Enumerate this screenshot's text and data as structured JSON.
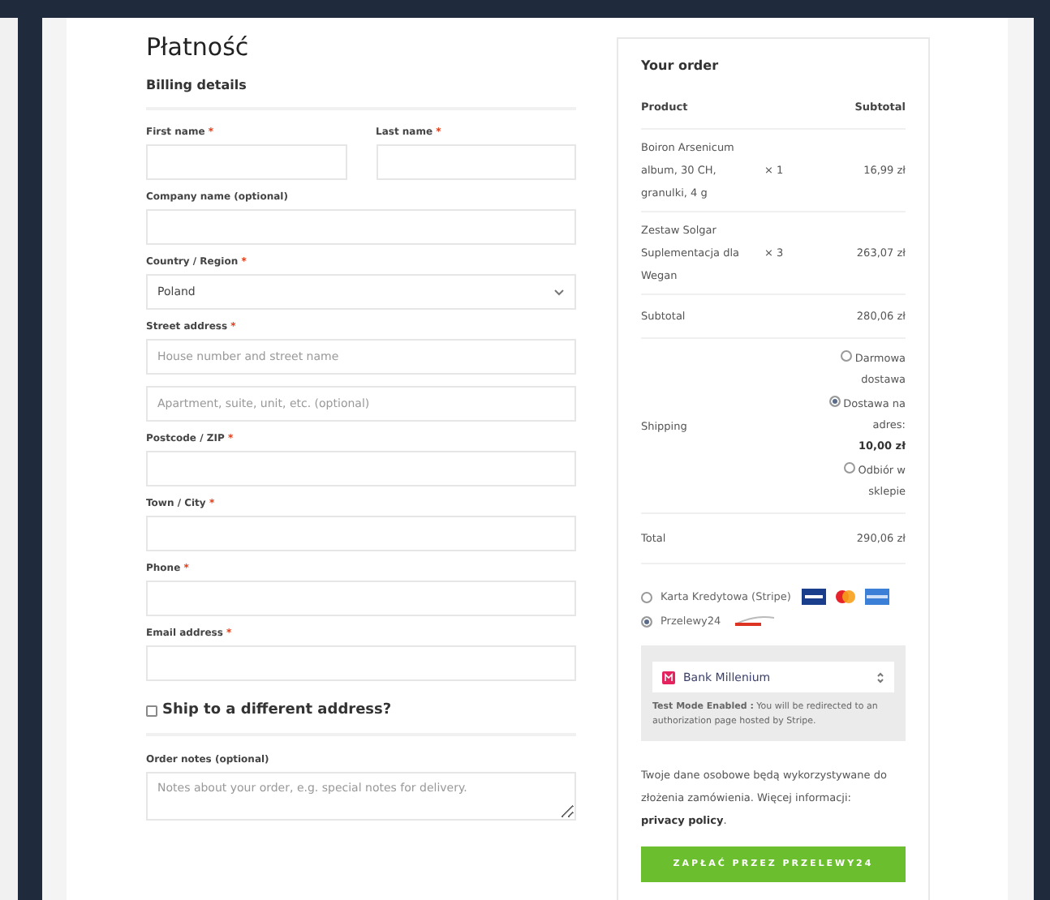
{
  "title": "Płatność",
  "billing": {
    "heading": "Billing details",
    "fields": [
      {
        "kind": "text",
        "label": "First name",
        "mark": "*",
        "half": true
      },
      {
        "kind": "text",
        "label": "Last name",
        "mark": "*",
        "half": true
      },
      {
        "kind": "text",
        "label": "Company name (optional)"
      },
      {
        "kind": "select",
        "label": "Country / Region",
        "mark": "*",
        "value": "Poland"
      },
      {
        "kind": "text",
        "label": "Street address",
        "mark": "*",
        "placeholder": "House number and street name"
      },
      {
        "kind": "text",
        "placeholder": "Apartment, suite, unit, etc. (optional)"
      },
      {
        "kind": "text",
        "label": "Postcode / ZIP",
        "mark": "*"
      },
      {
        "kind": "text",
        "label": "Town / City",
        "mark": "*"
      },
      {
        "kind": "text",
        "label": "Phone",
        "mark": "*"
      },
      {
        "kind": "text",
        "label": "Email address",
        "mark": "*"
      }
    ]
  },
  "ship_different": {
    "label": "Ship to a different address?",
    "checked": false
  },
  "notes": {
    "label": "Order notes (optional)",
    "placeholder": "Notes about your order, e.g. special notes for delivery."
  },
  "order": {
    "heading": "Your order",
    "columns": [
      "Product",
      "Subtotal"
    ],
    "items": [
      {
        "name": "Boiron Arsenicum album, 30 CH, granulki, 4 g",
        "qty": "× 1",
        "price": "16,99 zł"
      },
      {
        "name": "Zestaw Solgar Suplementacja dla Wegan",
        "qty": "× 3",
        "price": "263,07 zł"
      }
    ],
    "subtotal": {
      "label": "Subtotal",
      "value": "280,06 zł"
    },
    "shipping": {
      "label": "Shipping",
      "options": [
        {
          "label": "Darmowa dostawa",
          "selected": false
        },
        {
          "label": "Dostawa na adres:",
          "price": "10,00 zł",
          "selected": true
        },
        {
          "label": "Odbiór w sklepie",
          "selected": false
        }
      ]
    },
    "total": {
      "label": "Total",
      "value": "290,06 zł"
    }
  },
  "payment": {
    "methods": [
      {
        "label": "Karta Kredytowa (Stripe)",
        "kind": "cards",
        "selected": false
      },
      {
        "label": "Przelewy24",
        "kind": "p24",
        "selected": true
      }
    ],
    "bank": "Bank Millenium",
    "notice": "**Test Mode Enabled :** You will be redirected to an authorization page hosted by Stripe."
  },
  "privacy": {
    "text": "Twoje dane osobowe będą wykorzystywane do złożenia zamówienia. Więcej informacji: ",
    "link": "privacy policy",
    "end": "."
  },
  "pay_button": "ZAPŁAĆ PRZEZ PRZELEWY24"
}
